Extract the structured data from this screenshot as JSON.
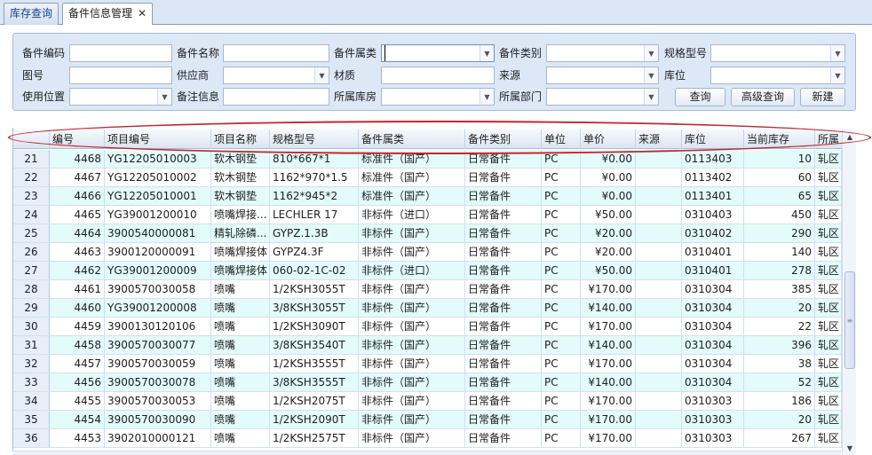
{
  "tabs": [
    {
      "label": "库存查询"
    },
    {
      "label": "备件信息管理",
      "close": "✕"
    }
  ],
  "filters": {
    "part_code_label": "备件编码",
    "part_name_label": "备件名称",
    "part_attr_label": "备件属类",
    "part_category_label": "备件类别",
    "spec_model_label": "规格型号",
    "drawing_no_label": "图号",
    "supplier_label": "供应商",
    "material_label": "材质",
    "source_label": "来源",
    "location_label": "库位",
    "use_position_label": "使用位置",
    "remark_label": "备注信息",
    "warehouse_label": "所属库房",
    "department_label": "所属部门"
  },
  "buttons": {
    "query": "查询",
    "advanced_query": "高级查询",
    "new": "新建"
  },
  "grid": {
    "columns": [
      "编号",
      "项目编号",
      "项目名称",
      "规格型号",
      "备件属类",
      "备件类别",
      "单位",
      "单价",
      "来源",
      "库位",
      "当前库存",
      "所属"
    ],
    "rows": [
      {
        "rn": "21",
        "id": "4468",
        "proj_no": "YG12205010003",
        "name": "软木钢垫",
        "spec": "810*667*1",
        "attr": "标准件（国产）",
        "cat": "日常备件",
        "unit": "PC",
        "price": "¥0.00",
        "src": "",
        "loc": "0113403",
        "stock": "10",
        "dept": "轧区"
      },
      {
        "rn": "22",
        "id": "4467",
        "proj_no": "YG12205010002",
        "name": "软木钢垫",
        "spec": "1162*970*1.5",
        "attr": "标准件（国产）",
        "cat": "日常备件",
        "unit": "PC",
        "price": "¥0.00",
        "src": "",
        "loc": "0113402",
        "stock": "60",
        "dept": "轧区"
      },
      {
        "rn": "23",
        "id": "4466",
        "proj_no": "YG12205010001",
        "name": "软木钢垫",
        "spec": "1162*945*2",
        "attr": "标准件（国产）",
        "cat": "日常备件",
        "unit": "PC",
        "price": "¥0.00",
        "src": "",
        "loc": "0113401",
        "stock": "65",
        "dept": "轧区"
      },
      {
        "rn": "24",
        "id": "4465",
        "proj_no": "YG39001200010",
        "name": "喷嘴焊接...",
        "spec": "LECHLER 17",
        "attr": "非标件（进口）",
        "cat": "日常备件",
        "unit": "PC",
        "price": "¥50.00",
        "src": "",
        "loc": "0310403",
        "stock": "450",
        "dept": "轧区"
      },
      {
        "rn": "25",
        "id": "4464",
        "proj_no": "3900540000081",
        "name": "精轧除磷...",
        "spec": "GYPZ.1.3B",
        "attr": "非标件（国产）",
        "cat": "日常备件",
        "unit": "PC",
        "price": "¥20.00",
        "src": "",
        "loc": "0310402",
        "stock": "290",
        "dept": "轧区"
      },
      {
        "rn": "26",
        "id": "4463",
        "proj_no": "3900120000091",
        "name": "喷嘴焊接体",
        "spec": "GYPZ4.3F",
        "attr": "非标件（国产）",
        "cat": "日常备件",
        "unit": "PC",
        "price": "¥20.00",
        "src": "",
        "loc": "0310401",
        "stock": "140",
        "dept": "轧区"
      },
      {
        "rn": "27",
        "id": "4462",
        "proj_no": "YG39001200009",
        "name": "喷嘴焊接体",
        "spec": "060-02-1C-02",
        "attr": "非标件（进口）",
        "cat": "日常备件",
        "unit": "PC",
        "price": "¥50.00",
        "src": "",
        "loc": "0310401",
        "stock": "278",
        "dept": "轧区"
      },
      {
        "rn": "28",
        "id": "4461",
        "proj_no": "3900570030058",
        "name": "喷嘴",
        "spec": "1/2KSH3055T",
        "attr": "非标件（国产）",
        "cat": "日常备件",
        "unit": "PC",
        "price": "¥170.00",
        "src": "",
        "loc": "0310304",
        "stock": "385",
        "dept": "轧区"
      },
      {
        "rn": "29",
        "id": "4460",
        "proj_no": "YG39001200008",
        "name": "喷嘴",
        "spec": "3/8KSH3055T",
        "attr": "非标件（国产）",
        "cat": "日常备件",
        "unit": "PC",
        "price": "¥140.00",
        "src": "",
        "loc": "0310304",
        "stock": "20",
        "dept": "轧区"
      },
      {
        "rn": "30",
        "id": "4459",
        "proj_no": "3900130120106",
        "name": "喷嘴",
        "spec": "1/2KSH3090T",
        "attr": "非标件（国产）",
        "cat": "日常备件",
        "unit": "PC",
        "price": "¥170.00",
        "src": "",
        "loc": "0310304",
        "stock": "22",
        "dept": "轧区"
      },
      {
        "rn": "31",
        "id": "4458",
        "proj_no": "3900570030077",
        "name": "喷嘴",
        "spec": "3/8KSH3540T",
        "attr": "非标件（国产）",
        "cat": "日常备件",
        "unit": "PC",
        "price": "¥140.00",
        "src": "",
        "loc": "0310304",
        "stock": "396",
        "dept": "轧区"
      },
      {
        "rn": "32",
        "id": "4457",
        "proj_no": "3900570030059",
        "name": "喷嘴",
        "spec": "1/2KSH3555T",
        "attr": "非标件（国产）",
        "cat": "日常备件",
        "unit": "PC",
        "price": "¥170.00",
        "src": "",
        "loc": "0310304",
        "stock": "38",
        "dept": "轧区"
      },
      {
        "rn": "33",
        "id": "4456",
        "proj_no": " 3900570030078",
        "name": "喷嘴",
        "spec": "3/8KSH3555T",
        "attr": "非标件（国产）",
        "cat": "日常备件",
        "unit": "PC",
        "price": "¥140.00",
        "src": "",
        "loc": "0310304",
        "stock": "52",
        "dept": "轧区"
      },
      {
        "rn": "34",
        "id": "4455",
        "proj_no": " 3900570030053",
        "name": "喷嘴",
        "spec": "1/2KSH2075T",
        "attr": "非标件（国产）",
        "cat": "日常备件",
        "unit": "PC",
        "price": "¥170.00",
        "src": "",
        "loc": "0310303",
        "stock": "186",
        "dept": "轧区"
      },
      {
        "rn": "35",
        "id": "4454",
        "proj_no": "3900570030090",
        "name": "喷嘴",
        "spec": "1/2KSH2090T",
        "attr": "非标件（国产）",
        "cat": "日常备件",
        "unit": "PC",
        "price": "¥170.00",
        "src": "",
        "loc": "0310303",
        "stock": "20",
        "dept": "轧区"
      },
      {
        "rn": "36",
        "id": "4453",
        "proj_no": "3902010000121",
        "name": "喷嘴",
        "spec": "1/2KSH2575T",
        "attr": "非标件（国产）",
        "cat": "日常备件",
        "unit": "PC",
        "price": "¥170.00",
        "src": "",
        "loc": "0310303",
        "stock": "267",
        "dept": "轧区"
      }
    ]
  },
  "scrollbar": {
    "thumb_grip": "≡"
  },
  "colors": {
    "annotation": "#c0282e",
    "row_alt": "#e3fbfb",
    "panel": "#dde8f6"
  }
}
